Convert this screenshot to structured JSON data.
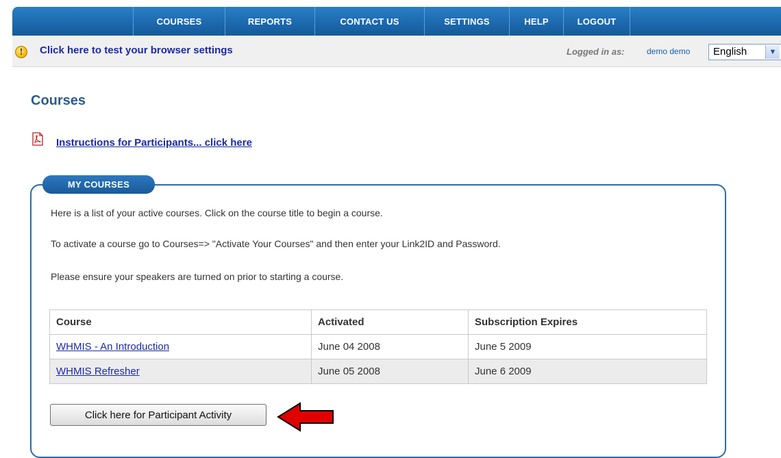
{
  "nav": {
    "items": [
      {
        "label": "COURSES"
      },
      {
        "label": "REPORTS"
      },
      {
        "label": "CONTACT US"
      },
      {
        "label": "SETTINGS"
      },
      {
        "label": "HELP"
      },
      {
        "label": "LOGOUT"
      }
    ]
  },
  "infobar": {
    "icon": "info-icon",
    "browser_link": "Click here to test your browser settings",
    "logged_in_label": "Logged in as:",
    "user_name": "demo demo",
    "language": "English"
  },
  "page": {
    "title": "Courses",
    "instructions_link": "Instructions for Participants... click here",
    "pdf_icon": "pdf-icon"
  },
  "my_courses": {
    "tab_label": "MY COURSES",
    "line1": "Here is a list of your active courses. Click on the course title to begin a course.",
    "line2": "To activate a course go to Courses=> \"Activate Your Courses\" and then enter your Link2ID and Password.",
    "line3": "Please ensure your speakers are turned on prior to starting a course.",
    "table": {
      "headers": [
        "Course",
        "Activated",
        "Subscription Expires"
      ],
      "rows": [
        {
          "course": "WHMIS - An Introduction",
          "activated": "June 04 2008",
          "expires": "June 5 2009"
        },
        {
          "course": "WHMIS Refresher",
          "activated": "June 05 2008",
          "expires": "June 6 2009"
        }
      ]
    },
    "activity_button": "Click here for Participant Activity"
  },
  "colors": {
    "nav_blue": "#1f6db3",
    "link_blue": "#1a2aa6",
    "heading_blue": "#2c5c8c",
    "panel_border": "#2d6aa8",
    "arrow_red": "#e00000"
  }
}
